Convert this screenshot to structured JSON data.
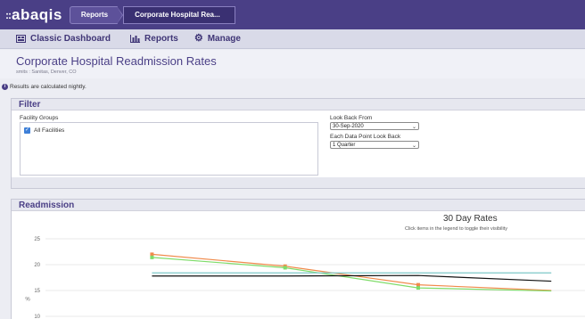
{
  "app": {
    "logo": "abaqis",
    "logo_dots": "::"
  },
  "breadcrumbs": [
    "Reports",
    "Corporate Hospital Rea..."
  ],
  "nav": {
    "dashboard": "Classic Dashboard",
    "reports": "Reports",
    "manage": "Manage"
  },
  "page": {
    "title": "Corporate Hospital Readmission Rates",
    "subtitle": "smits : Sanitas, Denver, CO",
    "notice": "Results are calculated nightly."
  },
  "filter": {
    "heading": "Filter",
    "facility_groups_label": "Facility Groups",
    "facility_option": "All Facilities",
    "facility_checked": true,
    "look_back_from_label": "Look Back From",
    "look_back_from_value": "30-Sep-2020",
    "each_point_label": "Each Data Point Look Back",
    "each_point_value": "1 Quarter"
  },
  "readmission": {
    "heading": "Readmission"
  },
  "chart_data": {
    "type": "line",
    "title": "30 Day Rates",
    "subtitle": "Click items in the legend to toggle their visibility",
    "ylabel": "%",
    "yticks": [
      10,
      15,
      20,
      25
    ],
    "ylim": [
      9.6,
      26
    ],
    "x": [
      1,
      2,
      3,
      4
    ],
    "xlim": [
      0.2,
      4.3
    ],
    "series": [
      {
        "color": "#f08a4b",
        "values": [
          22.0,
          19.7,
          16.1,
          15.0
        ],
        "markers": true
      },
      {
        "color": "#7fdc6a",
        "values": [
          21.4,
          19.4,
          15.5,
          14.9
        ],
        "markers": true
      },
      {
        "color": "#111111",
        "values": [
          17.8,
          17.8,
          17.9,
          16.8
        ],
        "markers": false
      },
      {
        "color": "#7ec8c8",
        "values": [
          18.4,
          18.4,
          18.4,
          18.4
        ],
        "markers": false
      }
    ],
    "grid": true
  },
  "colors": {
    "brand": "#4a3f86",
    "nav_bg": "#d9dae8",
    "accent_blue": "#3d7fd8"
  },
  "icons": {
    "dashboard": "dashboard-icon",
    "reports": "bar-chart-icon",
    "manage": "gear-icon",
    "info": "info-icon"
  }
}
